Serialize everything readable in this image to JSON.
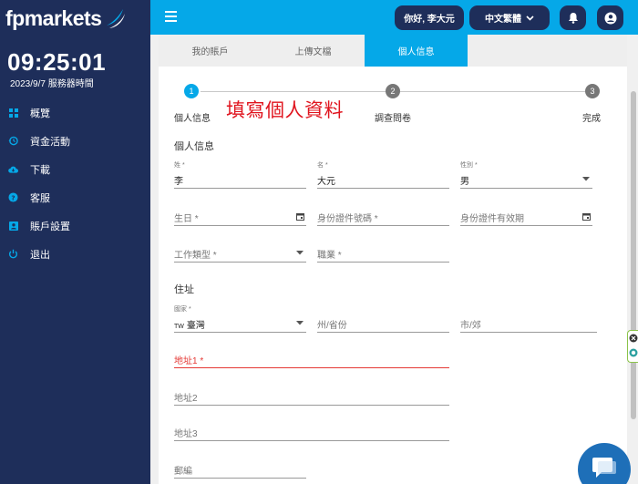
{
  "brand": {
    "name": "fpmarkets"
  },
  "clock": {
    "time": "09:25:01",
    "subtitle": "2023/9/7 服務器時間"
  },
  "sidebar": {
    "items": [
      {
        "label": "概覽",
        "icon": "grid-icon"
      },
      {
        "label": "資金活動",
        "icon": "history-icon"
      },
      {
        "label": "下載",
        "icon": "cloud-download-icon"
      },
      {
        "label": "客服",
        "icon": "help-icon"
      },
      {
        "label": "賬戶設置",
        "icon": "account-box-icon"
      },
      {
        "label": "退出",
        "icon": "power-icon"
      }
    ]
  },
  "topbar": {
    "greeting": "你好, 李大元",
    "language": "中文繁體",
    "accent": "#05a8e8",
    "navy": "#1e2e5a"
  },
  "tabs": [
    {
      "label": "我的賬戶",
      "active": false
    },
    {
      "label": "上傳文檔",
      "active": false
    },
    {
      "label": "個人信息",
      "active": true
    }
  ],
  "stepper": {
    "steps": [
      {
        "num": "1",
        "label": "個人信息",
        "active": true
      },
      {
        "num": "2",
        "label": "調查問卷",
        "active": false
      },
      {
        "num": "3",
        "label": "完成",
        "active": false
      }
    ],
    "annotation": "填寫個人資料"
  },
  "personal": {
    "title": "個人信息",
    "surname": {
      "label": "姓 *",
      "value": "李"
    },
    "given_name": {
      "label": "名 *",
      "value": "大元"
    },
    "gender": {
      "label": "性別 *",
      "value": "男"
    },
    "birthday": {
      "placeholder": "生日 *"
    },
    "id_number": {
      "placeholder": "身份證件號碼 *"
    },
    "id_expiry": {
      "placeholder": "身份證件有效期"
    },
    "job_type": {
      "placeholder": "工作類型 *"
    },
    "occupation": {
      "placeholder": "職業 *"
    }
  },
  "address": {
    "title": "住址",
    "country": {
      "label": "國家 *",
      "code": "TW",
      "value": "臺灣"
    },
    "state": {
      "placeholder": "州/省份"
    },
    "city": {
      "placeholder": "市/郊"
    },
    "line1": {
      "placeholder": "地址1 *"
    },
    "line2": {
      "placeholder": "地址2"
    },
    "line3": {
      "placeholder": "地址3"
    },
    "postcode": {
      "placeholder": "郵編"
    }
  }
}
